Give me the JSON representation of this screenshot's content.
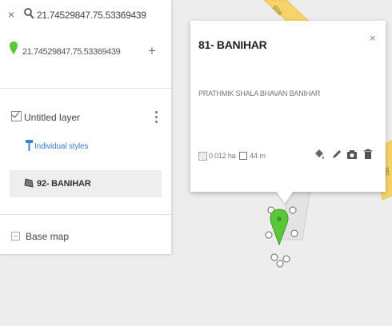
{
  "search": {
    "query": "21.74529847.75.53369439",
    "result_text": "21.74529847.75.53369439",
    "add_symbol": "+",
    "close_symbol": "×"
  },
  "layers": {
    "title": "Untitled layer",
    "styles_link": "Individual styles",
    "feature_label": "92- BANIHAR",
    "base_map_label": "Base map"
  },
  "popup": {
    "title": "81- BANIHAR",
    "description": "PRATHMIK SHALA BHAVAN BANIHAR",
    "area": "0.012 ha",
    "perimeter": "44 m",
    "close_symbol": "×"
  },
  "map": {
    "road_labels": [
      "Rla",
      "Rc"
    ]
  },
  "colors": {
    "pin": "#59c73a",
    "link": "#3f7fd0",
    "road": "#f5d46b"
  },
  "icons": [
    "search-icon",
    "map-pin-icon",
    "paint-bucket-icon",
    "polygon-icon",
    "paint-fill-icon",
    "pencil-icon",
    "camera-icon",
    "trash-icon"
  ]
}
